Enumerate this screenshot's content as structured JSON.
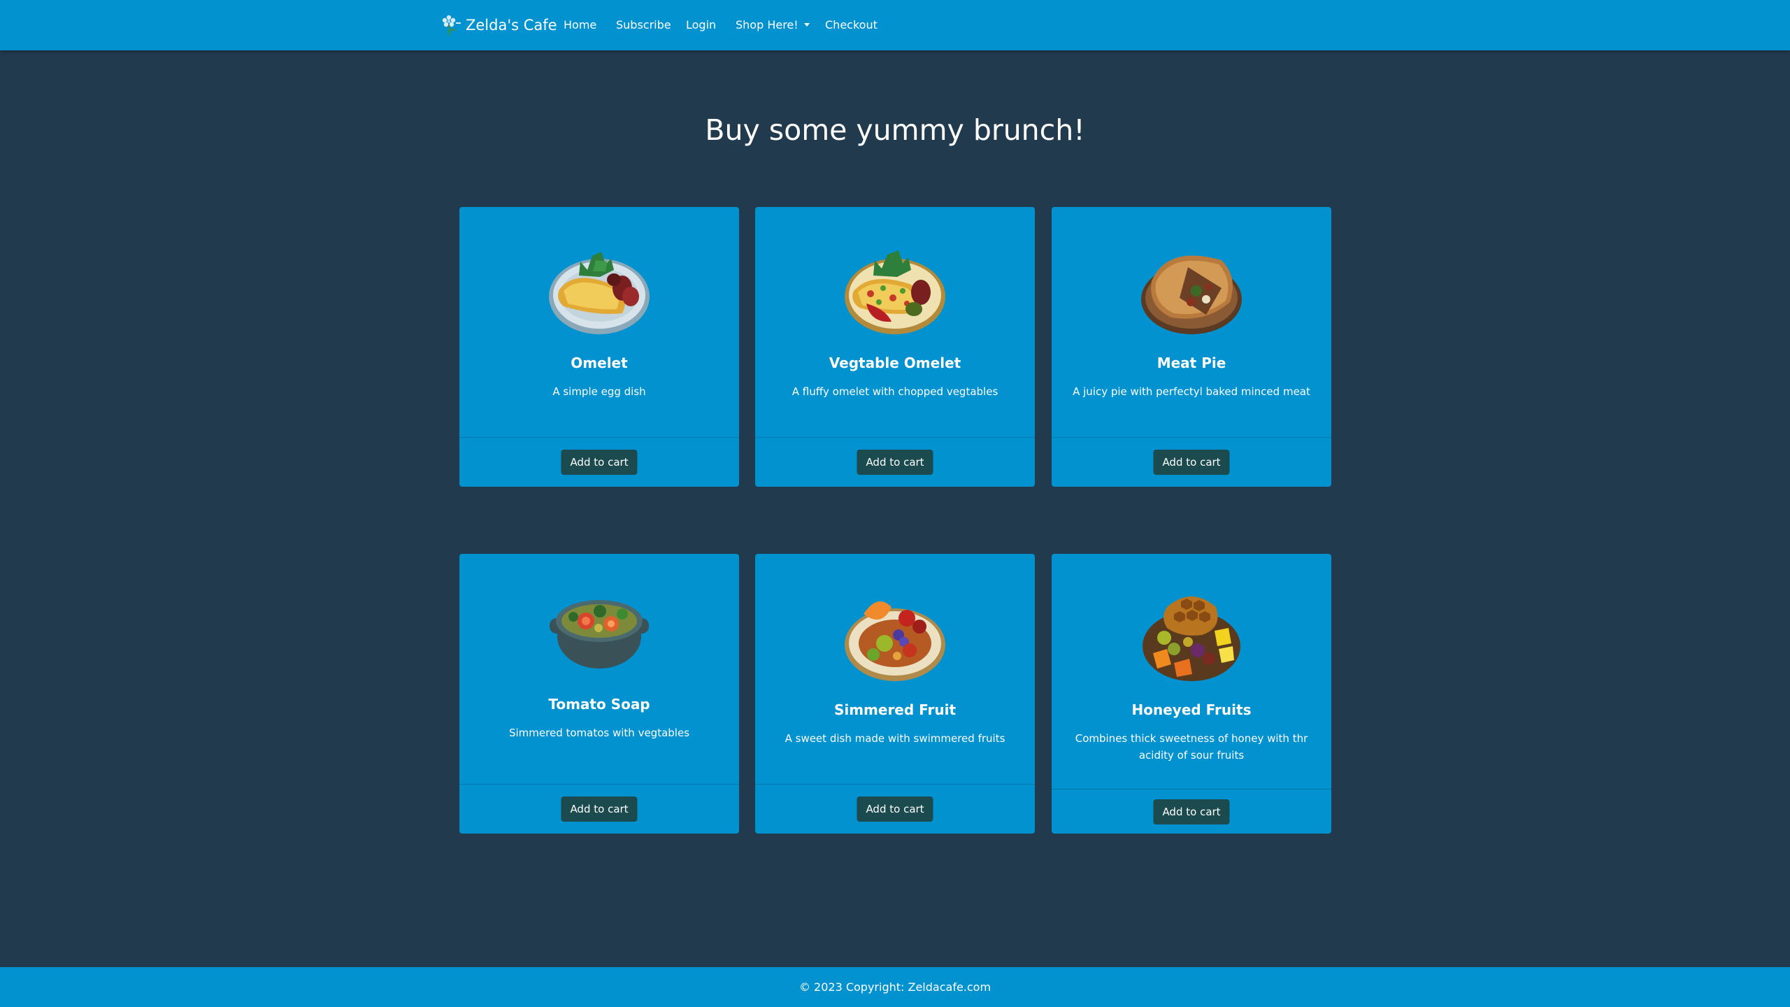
{
  "navbar": {
    "brand": "Zelda's Cafe",
    "links": {
      "home": "Home",
      "subscribe": "Subscribe",
      "login": "Login",
      "shop": "Shop Here!",
      "checkout": "Checkout"
    }
  },
  "main": {
    "title": "Buy some yummy brunch!",
    "products": [
      {
        "name": "Omelet",
        "description": "A simple egg dish",
        "button": "Add to cart"
      },
      {
        "name": "Vegtable Omelet",
        "description": "A fluffy omelet with chopped vegtables",
        "button": "Add to cart"
      },
      {
        "name": "Meat Pie",
        "description": "A juicy pie with perfectyl baked minced meat",
        "button": "Add to cart"
      },
      {
        "name": "Tomato Soap",
        "description": "Simmered tomatos with vegtables",
        "button": "Add to cart"
      },
      {
        "name": "Simmered Fruit",
        "description": "A sweet dish made with swimmered fruits",
        "button": "Add to cart"
      },
      {
        "name": "Honeyed Fruits",
        "description": "Combines thick sweetness of honey with thr acidity of sour fruits",
        "button": "Add to cart"
      }
    ]
  },
  "footer": {
    "text": "© 2023 Copyright: Zeldacafe.com"
  },
  "colors": {
    "background": "#223a4e",
    "primary": "#0292cf",
    "button": "#1b4b4f",
    "text": "#ffffff"
  }
}
